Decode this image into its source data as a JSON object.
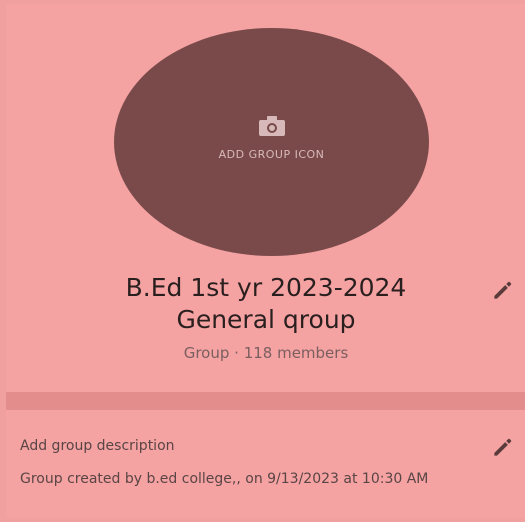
{
  "group": {
    "add_icon_label": "ADD GROUP ICON",
    "name_line1": "B.Ed 1st yr 2023-2024",
    "name_line2": "General qroup",
    "meta": "Group · 118 members"
  },
  "description": {
    "add_label": "Add group description",
    "created_info": "Group created by b.ed college,, on 9/13/2023 at 10:30 AM"
  },
  "icons": {
    "camera": "camera-icon",
    "edit": "pencil-icon"
  },
  "colors": {
    "background": "#f4a2a2",
    "avatar": "#7a4a4a",
    "separator": "#e48d8d"
  }
}
